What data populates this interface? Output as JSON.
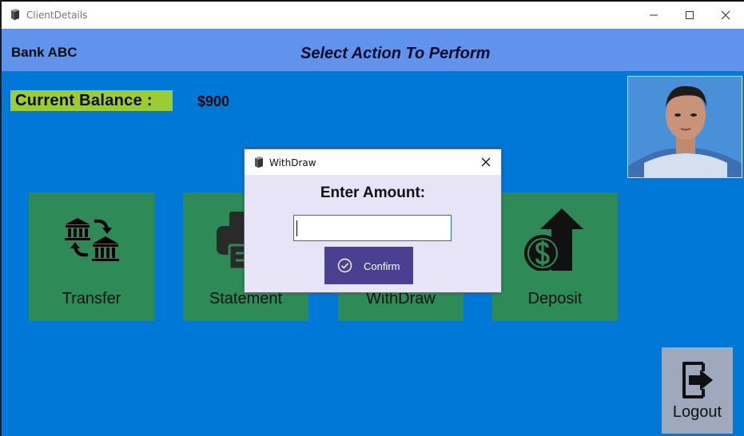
{
  "window": {
    "title": "ClientDetails"
  },
  "header": {
    "bank_name": "Bank ABC",
    "action_title": "Select Action To Perform"
  },
  "balance": {
    "label": "Current Balance :",
    "value": "$900"
  },
  "tiles": [
    {
      "label": "Transfer",
      "icon": "bank-transfer-icon"
    },
    {
      "label": "Statement",
      "icon": "printer-icon"
    },
    {
      "label": "WithDraw",
      "icon": "withdraw-icon"
    },
    {
      "label": "Deposit",
      "icon": "dollar-deposit-icon"
    }
  ],
  "logout": {
    "label": "Logout",
    "icon": "logout-icon"
  },
  "dialog": {
    "title": "WithDraw",
    "prompt": "Enter Amount:",
    "amount_value": "",
    "confirm_label": "Confirm"
  },
  "colors": {
    "background": "#0078d7",
    "header": "#5f93ec",
    "balance_label_bg": "#9acd32",
    "tile": "#2e8b57",
    "logout": "#9ea9bd",
    "confirm": "#4b3f91",
    "dialog_bg": "#e7e4f7"
  }
}
